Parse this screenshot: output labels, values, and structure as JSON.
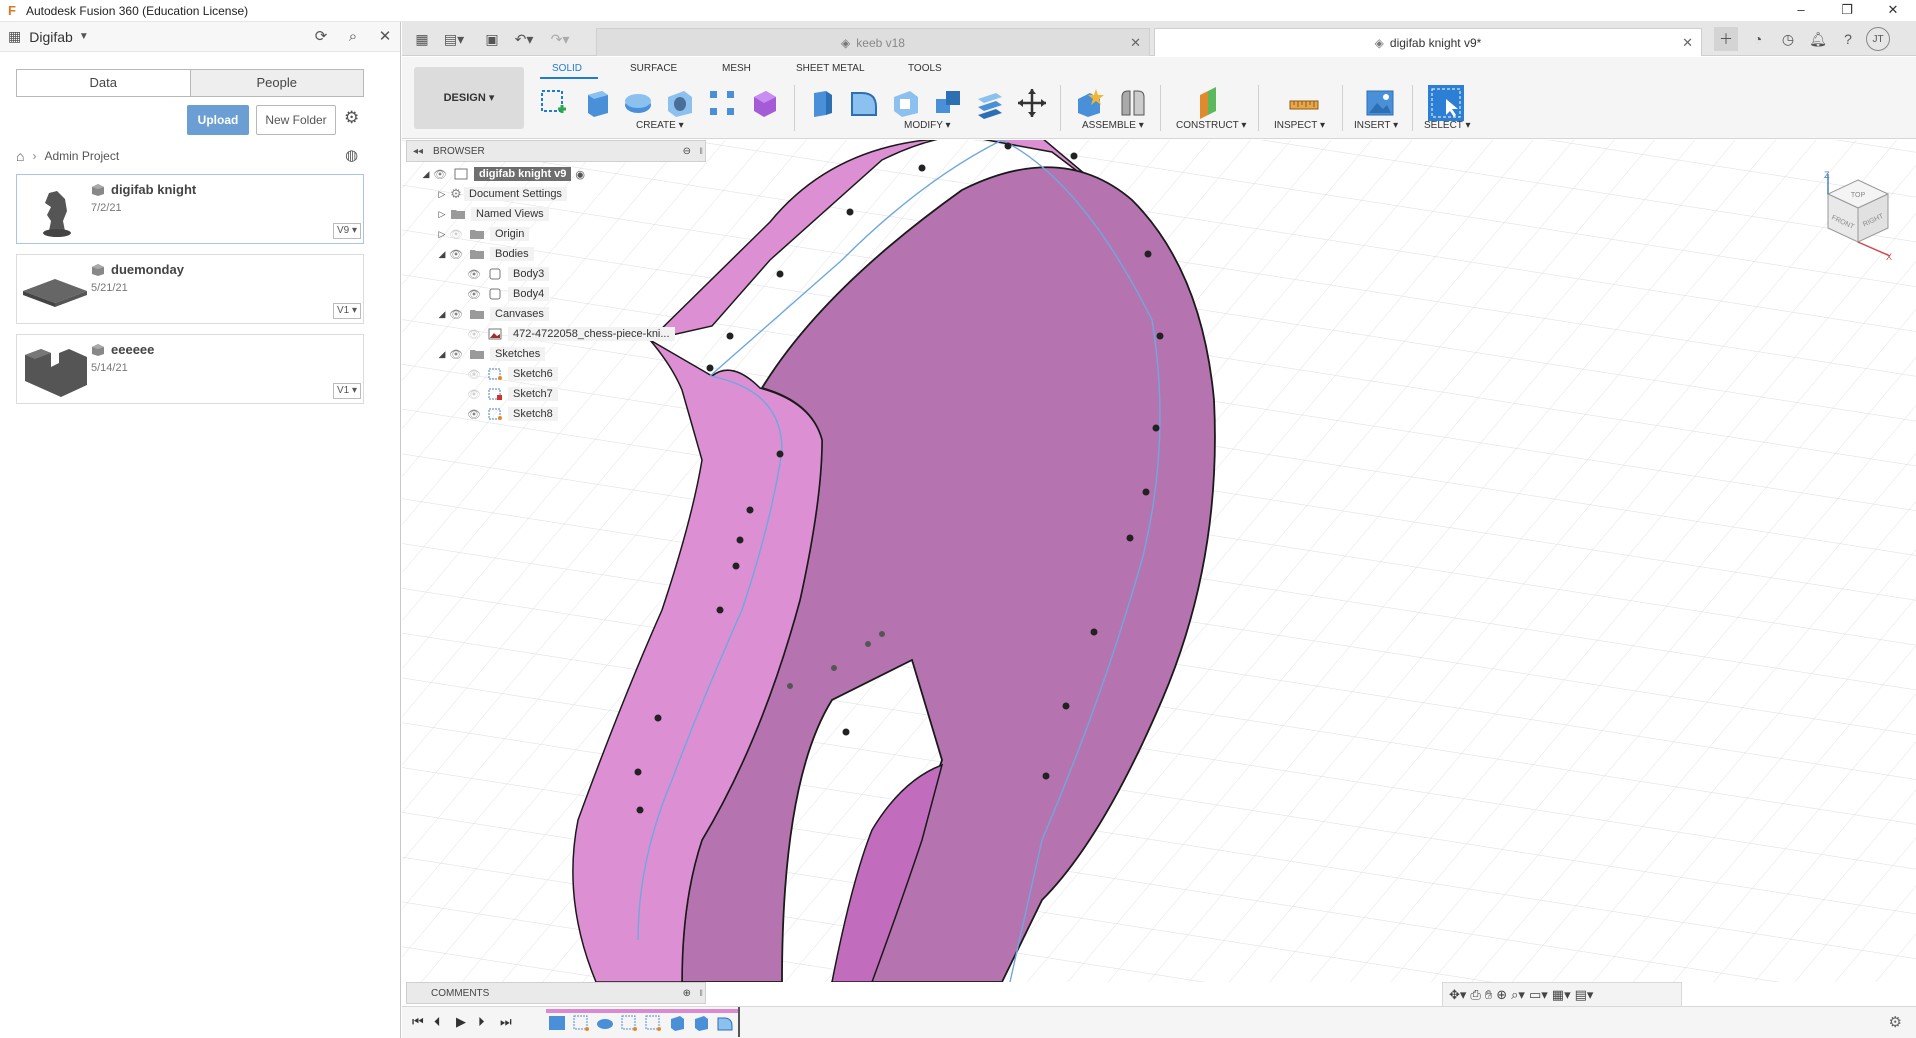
{
  "window": {
    "title": "Autodesk Fusion 360 (Education License)",
    "minimize": "–",
    "restore": "❐",
    "close": "✕"
  },
  "data_panel": {
    "team": "Digifab",
    "tabs": [
      "Data",
      "People"
    ],
    "upload_label": "Upload",
    "new_folder_label": "New Folder",
    "breadcrumb": "Admin Project",
    "files": [
      {
        "name": "digifab knight",
        "date": "7/2/21",
        "version": "V9 ▾"
      },
      {
        "name": "duemonday",
        "date": "5/21/21",
        "version": "V1 ▾"
      },
      {
        "name": "eeeeee",
        "date": "5/14/21",
        "version": "V1 ▾"
      }
    ]
  },
  "tabs": {
    "doc1": "keeb v18",
    "doc2": "digifab knight v9*",
    "user_initials": "JT"
  },
  "toolbar": {
    "workspace": "DESIGN ▾",
    "tool_tabs": [
      "SOLID",
      "SURFACE",
      "MESH",
      "SHEET METAL",
      "TOOLS"
    ],
    "groups": [
      "CREATE ▾",
      "MODIFY ▾",
      "ASSEMBLE ▾",
      "CONSTRUCT ▾",
      "INSPECT ▾",
      "INSERT ▾",
      "SELECT ▾"
    ]
  },
  "browser": {
    "title": "BROWSER",
    "root": "digifab knight v9",
    "items": {
      "document_settings": "Document Settings",
      "named_views": "Named Views",
      "origin": "Origin",
      "bodies": "Bodies",
      "body3": "Body3",
      "body4": "Body4",
      "canvases": "Canvases",
      "canvas1": "472-4722058_chess-piece-kni...",
      "sketches": "Sketches",
      "sketch6": "Sketch6",
      "sketch7": "Sketch7",
      "sketch8": "Sketch8"
    }
  },
  "comments": {
    "title": "COMMENTS"
  },
  "viewcube": {
    "top": "TOP",
    "front": "FRONT",
    "right": "RIGHT",
    "z": "Z",
    "x": "X"
  },
  "colors": {
    "body": "#d98ad0",
    "accent": "#1f7bd8",
    "upload": "#6b9ed3"
  }
}
